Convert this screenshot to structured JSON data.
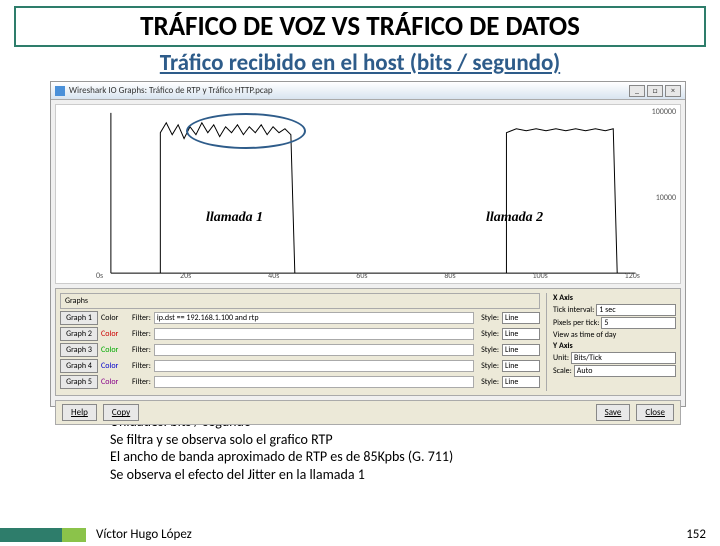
{
  "title": "TRÁFICO DE VOZ VS TRÁFICO DE DATOS",
  "subtitle": "Tráfico recibido en el host (bits / segundo)",
  "window": {
    "title": "Wireshark IO Graphs: Tráfico de RTP y Tráfico HTTP.pcap",
    "min": "_",
    "max": "□",
    "close": "×"
  },
  "chart_data": {
    "type": "line",
    "xlabel": "",
    "ylabel": "",
    "xlim": [
      0,
      130
    ],
    "ylim_log": [
      1000,
      100000
    ],
    "x_ticks": [
      "0s",
      "20s",
      "40s",
      "60s",
      "80s",
      "100s",
      "120s"
    ],
    "y_ticks": [
      "100000",
      "10000"
    ],
    "series": [
      {
        "name": "llamada 1",
        "x_range": [
          12,
          50
        ],
        "approx_level": 85000,
        "jitter": true
      },
      {
        "name": "llamada 2",
        "x_range": [
          95,
          126
        ],
        "approx_level": 85000,
        "jitter": false
      }
    ],
    "annotations": [
      "llamada 1",
      "llamada 2"
    ],
    "title": ""
  },
  "labels": {
    "call1": "llamada 1",
    "call2": "llamada 2"
  },
  "graphs_panel": {
    "header": "Graphs",
    "rows": [
      {
        "btn": "Graph 1",
        "color": "Color",
        "filter_label": "Filter:",
        "filter": "ip.dst == 192.168.1.100 and rtp",
        "style_label": "Style:",
        "style": "Line"
      },
      {
        "btn": "Graph 2",
        "color": "Color",
        "filter_label": "Filter:",
        "filter": "",
        "style_label": "Style:",
        "style": "Line"
      },
      {
        "btn": "Graph 3",
        "color": "Color",
        "filter_label": "Filter:",
        "filter": "",
        "style_label": "Style:",
        "style": "Line"
      },
      {
        "btn": "Graph 4",
        "color": "Color",
        "filter_label": "Filter:",
        "filter": "",
        "style_label": "Style:",
        "style": "Line"
      },
      {
        "btn": "Graph 5",
        "color": "Color",
        "filter_label": "Filter:",
        "filter": "",
        "style_label": "Style:",
        "style": "Line"
      }
    ],
    "colors": [
      "#000",
      "#c00",
      "#0a0",
      "#00c",
      "#808"
    ]
  },
  "xaxis": {
    "header": "X Axis",
    "tick_label": "Tick interval:",
    "tick_val": "1 sec",
    "pix_label": "Pixels per tick:",
    "pix_val": "5",
    "view_label": "View as time of day"
  },
  "yaxis": {
    "header": "Y Axis",
    "unit_label": "Unit:",
    "unit_val": "Bits/Tick",
    "scale_label": "Scale:",
    "scale_val": "Auto"
  },
  "buttons": {
    "help": "Help",
    "copy": "Copy",
    "save": "Save",
    "close": "Close"
  },
  "notes": {
    "l1": "Unidades: bits / segundo",
    "l2": "Se filtra y se observa solo el grafico RTP",
    "l3": "El ancho de banda aproximado de RTP es de 85Kpbs (G. 711)",
    "l4": "Se observa el efecto del Jitter en la llamada 1"
  },
  "footer": {
    "author": "Víctor Hugo López",
    "page": "152"
  }
}
